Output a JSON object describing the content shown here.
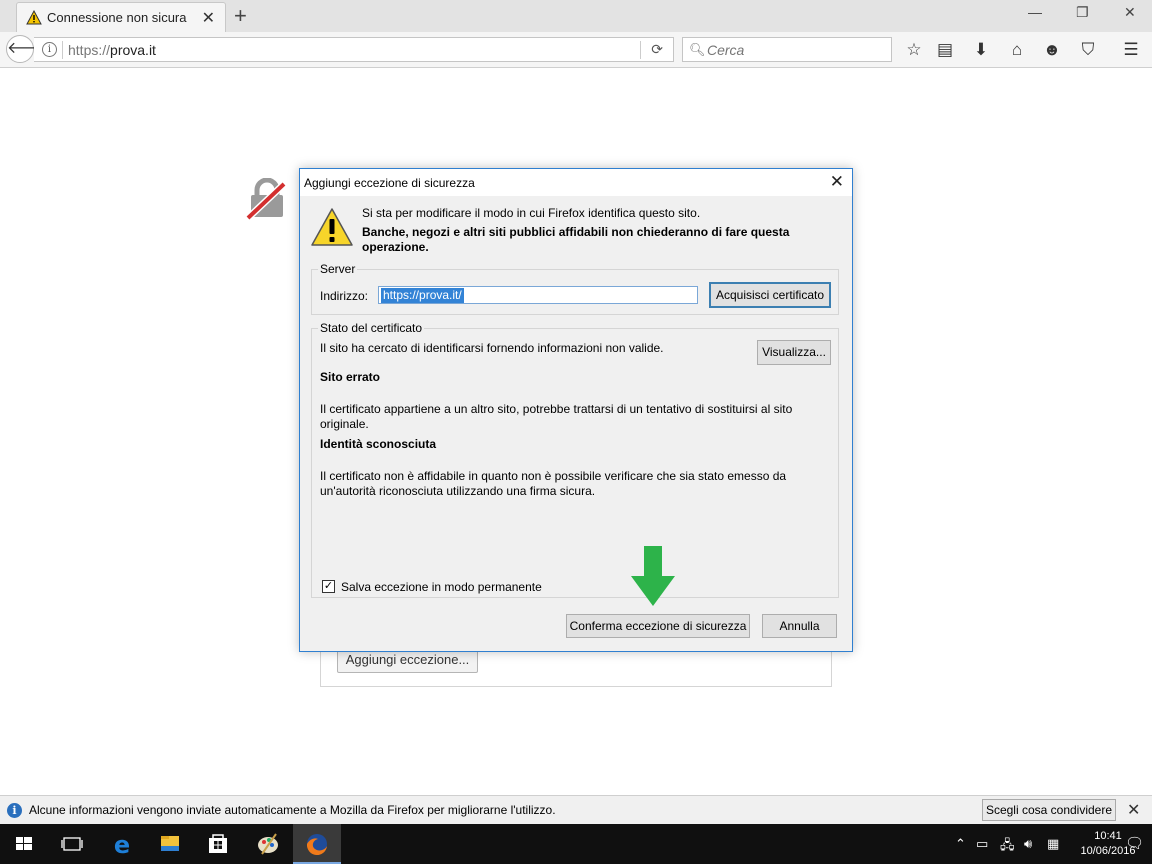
{
  "browser": {
    "tab_title": "Connessione non sicura",
    "tab_close": "✕",
    "new_tab": "+",
    "window_controls": {
      "minimize": "—",
      "restore": "❐",
      "close": "✕"
    },
    "url_scheme": "https://",
    "url_host": "prova.it",
    "search_placeholder": "Cerca"
  },
  "page": {
    "add_exception_button": "Aggiungi eccezione..."
  },
  "dialog": {
    "title": "Aggiungi eccezione di sicurezza",
    "close": "✕",
    "message_line": "Si sta per modificare il modo in cui Firefox identifica questo sito.",
    "message_bold": "Banche, negozi e altri siti pubblici affidabili non chiederanno di fare questa operazione.",
    "server_group": "Server",
    "address_label": "Indirizzo:",
    "address_value": "https://prova.it/",
    "get_certificate_button": "Acquisisci certificato",
    "cert_status_group": "Stato del certificato",
    "cert_intro": "Il sito ha cercato di identificarsi fornendo informazioni non valide.",
    "view_button": "Visualizza...",
    "wrong_site_title": "Sito errato",
    "wrong_site_text": "Il certificato appartiene a un altro sito, potrebbe trattarsi di un tentativo di sostituirsi al sito originale.",
    "unknown_identity_title": "Identità sconosciuta",
    "unknown_identity_text": "Il certificato non è affidabile in quanto non è possibile verificare che sia stato emesso da un'autorità riconosciuta utilizzando una firma sicura.",
    "permanent_checkbox_label": "Salva eccezione in modo permanente",
    "permanent_checked": true,
    "confirm_button": "Conferma eccezione di sicurezza",
    "cancel_button": "Annulla"
  },
  "notification": {
    "text": "Alcune informazioni vengono inviate automaticamente a Mozilla da Firefox per migliorarne l'utilizzo.",
    "button": "Scegli cosa condividere",
    "close": "✕"
  },
  "taskbar": {
    "time": "10:41",
    "date": "10/06/2016"
  },
  "colors": {
    "accent_arrow": "#2db34a",
    "selection": "#3383d6",
    "dialog_border": "#2f7fd0"
  }
}
